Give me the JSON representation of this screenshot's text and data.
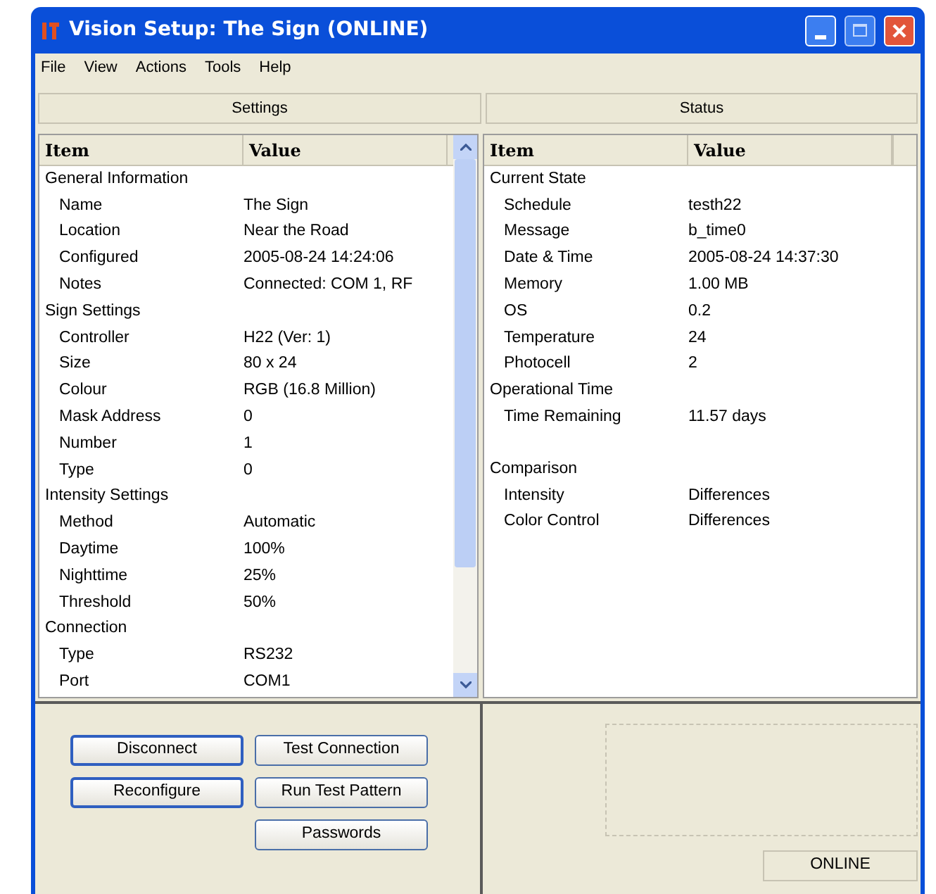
{
  "window": {
    "title": "Vision Setup: The Sign (ONLINE)"
  },
  "menu": [
    "File",
    "View",
    "Actions",
    "Tools",
    "Help"
  ],
  "settings": {
    "heading": "Settings",
    "columns": [
      "Item",
      "Value"
    ],
    "groups": [
      {
        "label": "General Information",
        "children": [
          {
            "item": "Name",
            "value": "The Sign"
          },
          {
            "item": "Location",
            "value": "Near the Road"
          },
          {
            "item": "Configured",
            "value": "2005-08-24  14:24:06"
          },
          {
            "item": "Notes",
            "value": "Connected: COM 1, RF"
          }
        ]
      },
      {
        "label": "Sign Settings",
        "children": [
          {
            "item": "Controller",
            "value": "H22 (Ver: 1)"
          },
          {
            "item": "Size",
            "value": "80 x 24"
          },
          {
            "item": "Colour",
            "value": "RGB (16.8 Million)"
          },
          {
            "item": "Mask Address",
            "value": "0"
          },
          {
            "item": "Number",
            "value": "1"
          },
          {
            "item": "Type",
            "value": "0"
          }
        ]
      },
      {
        "label": "Intensity Settings",
        "children": [
          {
            "item": "Method",
            "value": "Automatic"
          },
          {
            "item": "Daytime",
            "value": "100%"
          },
          {
            "item": "Nighttime",
            "value": "25%"
          },
          {
            "item": "Threshold",
            "value": "50%"
          }
        ]
      },
      {
        "label": "Connection",
        "children": [
          {
            "item": "Type",
            "value": "RS232"
          },
          {
            "item": "Port",
            "value": "COM1"
          }
        ]
      }
    ]
  },
  "status": {
    "heading": "Status",
    "columns": [
      "Item",
      "Value"
    ],
    "groups": [
      {
        "label": "Current State",
        "children": [
          {
            "item": "Schedule",
            "value": "testh22"
          },
          {
            "item": "Message",
            "value": "b_time0"
          },
          {
            "item": "Date & Time",
            "value": "2005-08-24  14:37:30"
          },
          {
            "item": "Memory",
            "value": "1.00 MB"
          },
          {
            "item": "OS",
            "value": "0.2"
          },
          {
            "item": "Temperature",
            "value": "24"
          },
          {
            "item": "Photocell",
            "value": "2"
          }
        ]
      },
      {
        "label": "Operational Time",
        "children": [
          {
            "item": "Time Remaining",
            "value": "11.57 days"
          }
        ]
      },
      {
        "label": "Comparison",
        "gap_before": true,
        "children": [
          {
            "item": "Intensity",
            "value": "Differences"
          },
          {
            "item": "Color Control",
            "value": "Differences"
          }
        ]
      }
    ]
  },
  "buttons": [
    [
      {
        "label": "Disconnect",
        "focused": true
      },
      {
        "label": "Test Connection",
        "focused": false
      }
    ],
    [
      {
        "label": "Reconfigure",
        "focused": true
      },
      {
        "label": "Run Test Pattern",
        "focused": false
      }
    ],
    [
      {
        "label": "Passwords",
        "focused": false
      }
    ]
  ],
  "status_bar": "ONLINE"
}
